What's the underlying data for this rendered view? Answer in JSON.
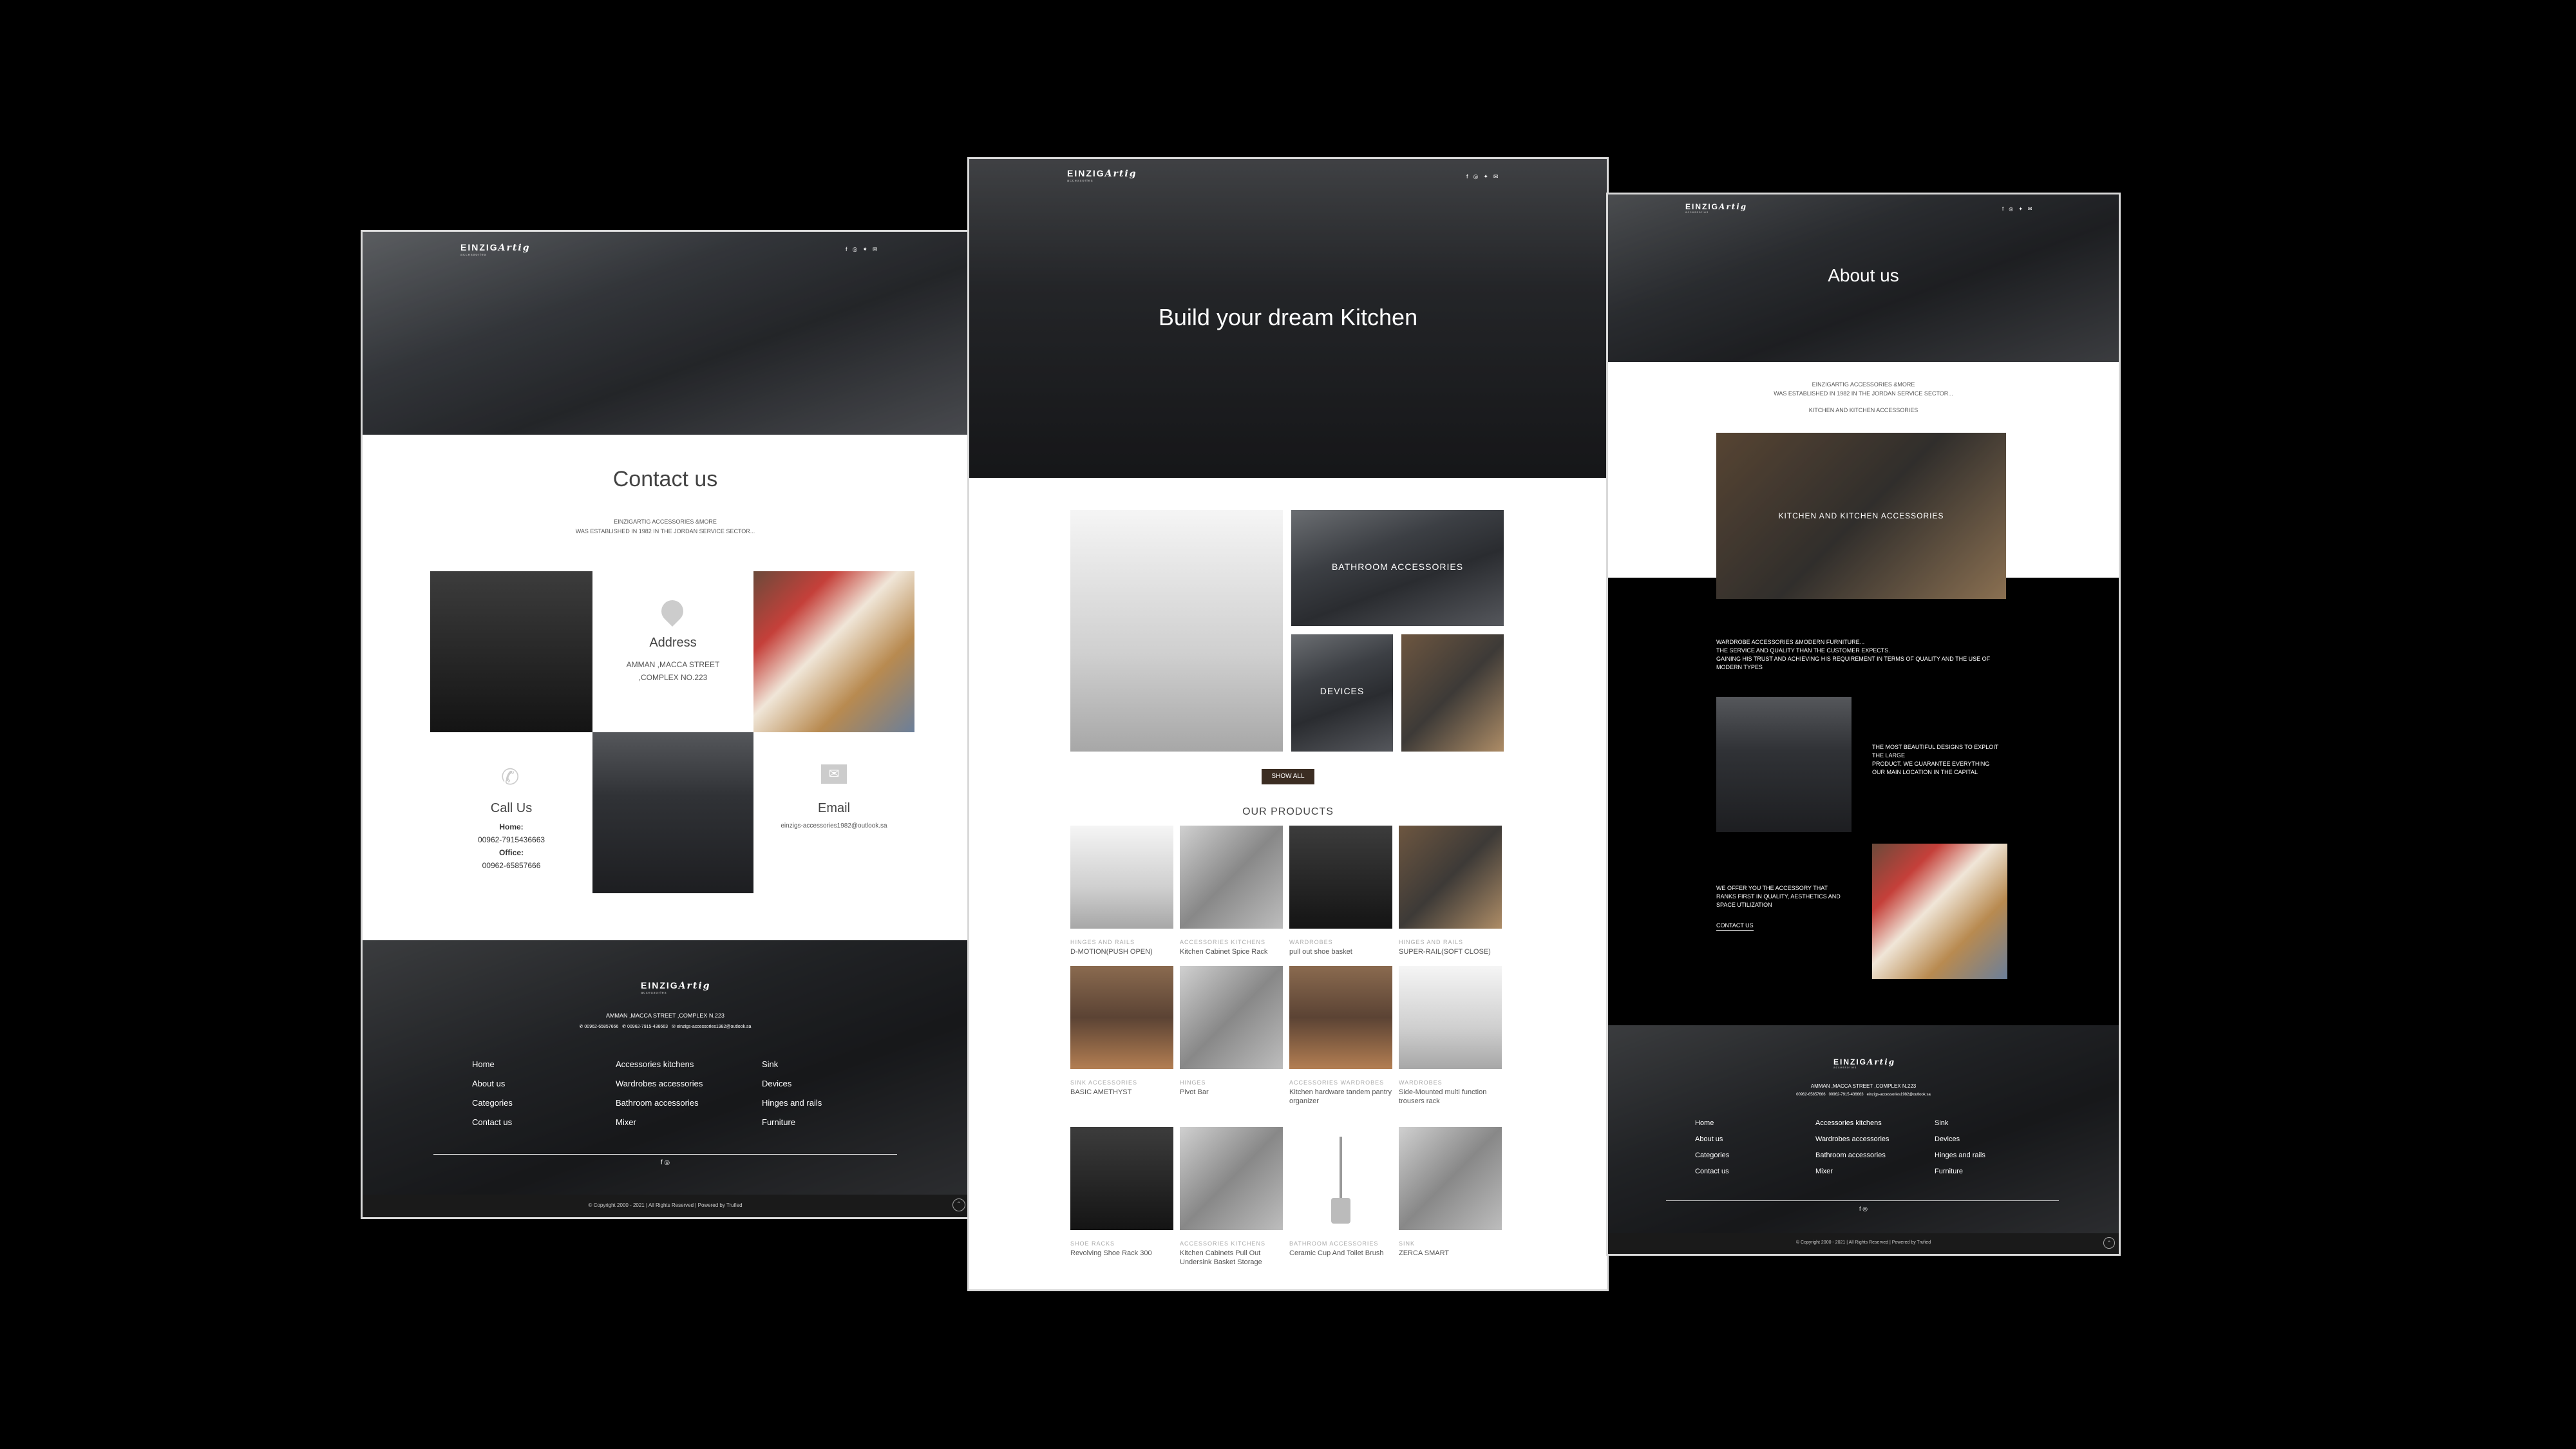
{
  "brand": {
    "logo": "EINZIG",
    "logo_script": "Artig",
    "logo_sub": "accessories"
  },
  "contact_page": {
    "title": "Contact us",
    "intro_line1": "EINZIGARTIG ACCESSORIES &MORE",
    "intro_line2": "WAS ESTABLISHED IN 1982 IN THE JORDAN SERVICE SECTOR...",
    "address": {
      "label": "Address",
      "line1": "AMMAN ,MACCA STREET",
      "line2": ",COMPLEX NO.223"
    },
    "call": {
      "label": "Call Us",
      "home_label": "Home:",
      "home": "00962-7915436663",
      "office_label": "Office:",
      "office": "00962-65857666"
    },
    "email": {
      "label": "Email",
      "value": "einzigs-accessories1982@outlook.sa"
    }
  },
  "home_page": {
    "hero_title": "Build your dream Kitchen",
    "categories": [
      "BATHROOM ACCESSORIES",
      "DEVICES"
    ],
    "show_all": "SHOW ALL",
    "products_title": "OUR PRODUCTS",
    "products": [
      {
        "cat": "HINGES AND RAILS",
        "name": "D-MOTION(PUSH OPEN)"
      },
      {
        "cat": "ACCESSORIES KITCHENS",
        "name": "Kitchen Cabinet Spice Rack"
      },
      {
        "cat": "WARDROBES",
        "name": "pull out shoe basket"
      },
      {
        "cat": "HINGES AND RAILS",
        "name": "SUPER-RAIL(SOFT CLOSE)"
      },
      {
        "cat": "SINK ACCESSORIES",
        "name": "BASIC AMETHYST"
      },
      {
        "cat": "HINGES",
        "name": "Pivot Bar"
      },
      {
        "cat": "ACCESSORIES WARDROBES",
        "name": "Kitchen hardware tandem pantry organizer"
      },
      {
        "cat": "WARDROBES",
        "name": "Side-Mounted multi function trousers rack"
      },
      {
        "cat": "SHOE RACKS",
        "name": "Revolving Shoe Rack 300"
      },
      {
        "cat": "ACCESSORIES KITCHENS",
        "name": "Kitchen Cabinets Pull Out Undersink Basket Storage"
      },
      {
        "cat": "BATHROOM ACCESSORIES",
        "name": "Ceramic Cup And Toilet Brush"
      },
      {
        "cat": "SINK",
        "name": "ZERCA SMART"
      }
    ]
  },
  "about_page": {
    "hero_title": "About us",
    "intro_line1": "EINZIGARTIG ACCESSORIES &MORE",
    "intro_line2": "WAS ESTABLISHED IN 1982 IN THE JORDAN SERVICE SECTOR...",
    "intro_line3": "KITCHEN AND KITCHEN ACCESSORIES",
    "banner_caption": "KITCHEN AND KITCHEN ACCESSORIES",
    "para1_l1": "WARDROBE ACCESSORIES &MODERN FURNITURE...",
    "para1_l2": "THE SERVICE AND QUALITY THAN THE CUSTOMER EXPECTS.",
    "para1_l3": "GAINING HIS TRUST AND ACHIEVING HIS REQUIREMENT IN TERMS OF QUALITY AND THE USE OF",
    "para1_l4": "MODERN TYPES",
    "para2_l1": "THE MOST BEAUTIFUL DESIGNS TO EXPLOIT",
    "para2_l2": "THE LARGE",
    "para2_l3": "PRODUCT. WE GUARANTEE EVERYTHING",
    "para2_l4": "OUR MAIN LOCATION IN THE CAPITAL",
    "para3_l1": "WE OFFER YOU THE ACCESSORY THAT",
    "para3_l2": "RANKS FIRST IN QUALITY, AESTHETICS AND",
    "para3_l3": "SPACE UTILIZATION",
    "contact_link": "CONTACT US"
  },
  "footer": {
    "address": "AMMAN ,MACCA STREET ,COMPLEX N.223",
    "phone1": "00962-65857666",
    "phone2": "00962-7915-436663",
    "email": "einzigs-accessories1982@outlook.sa",
    "col1": [
      "Home",
      "About us",
      "Categories",
      "Contact us"
    ],
    "col2": [
      "Accessories kitchens",
      "Wardrobes accessories",
      "Bathroom accessories",
      "Mixer"
    ],
    "col3": [
      "Sink",
      "Devices",
      "Hinges and rails",
      "Furniture"
    ],
    "copyright": "© Copyright 2000 - 2021 | All Rights Reserved | Powered by Trufied"
  },
  "icons": [
    "facebook-icon",
    "instagram-icon",
    "twitter-icon",
    "mail-icon",
    "location-icon",
    "phone-icon",
    "email-icon",
    "scroll-top-icon"
  ]
}
